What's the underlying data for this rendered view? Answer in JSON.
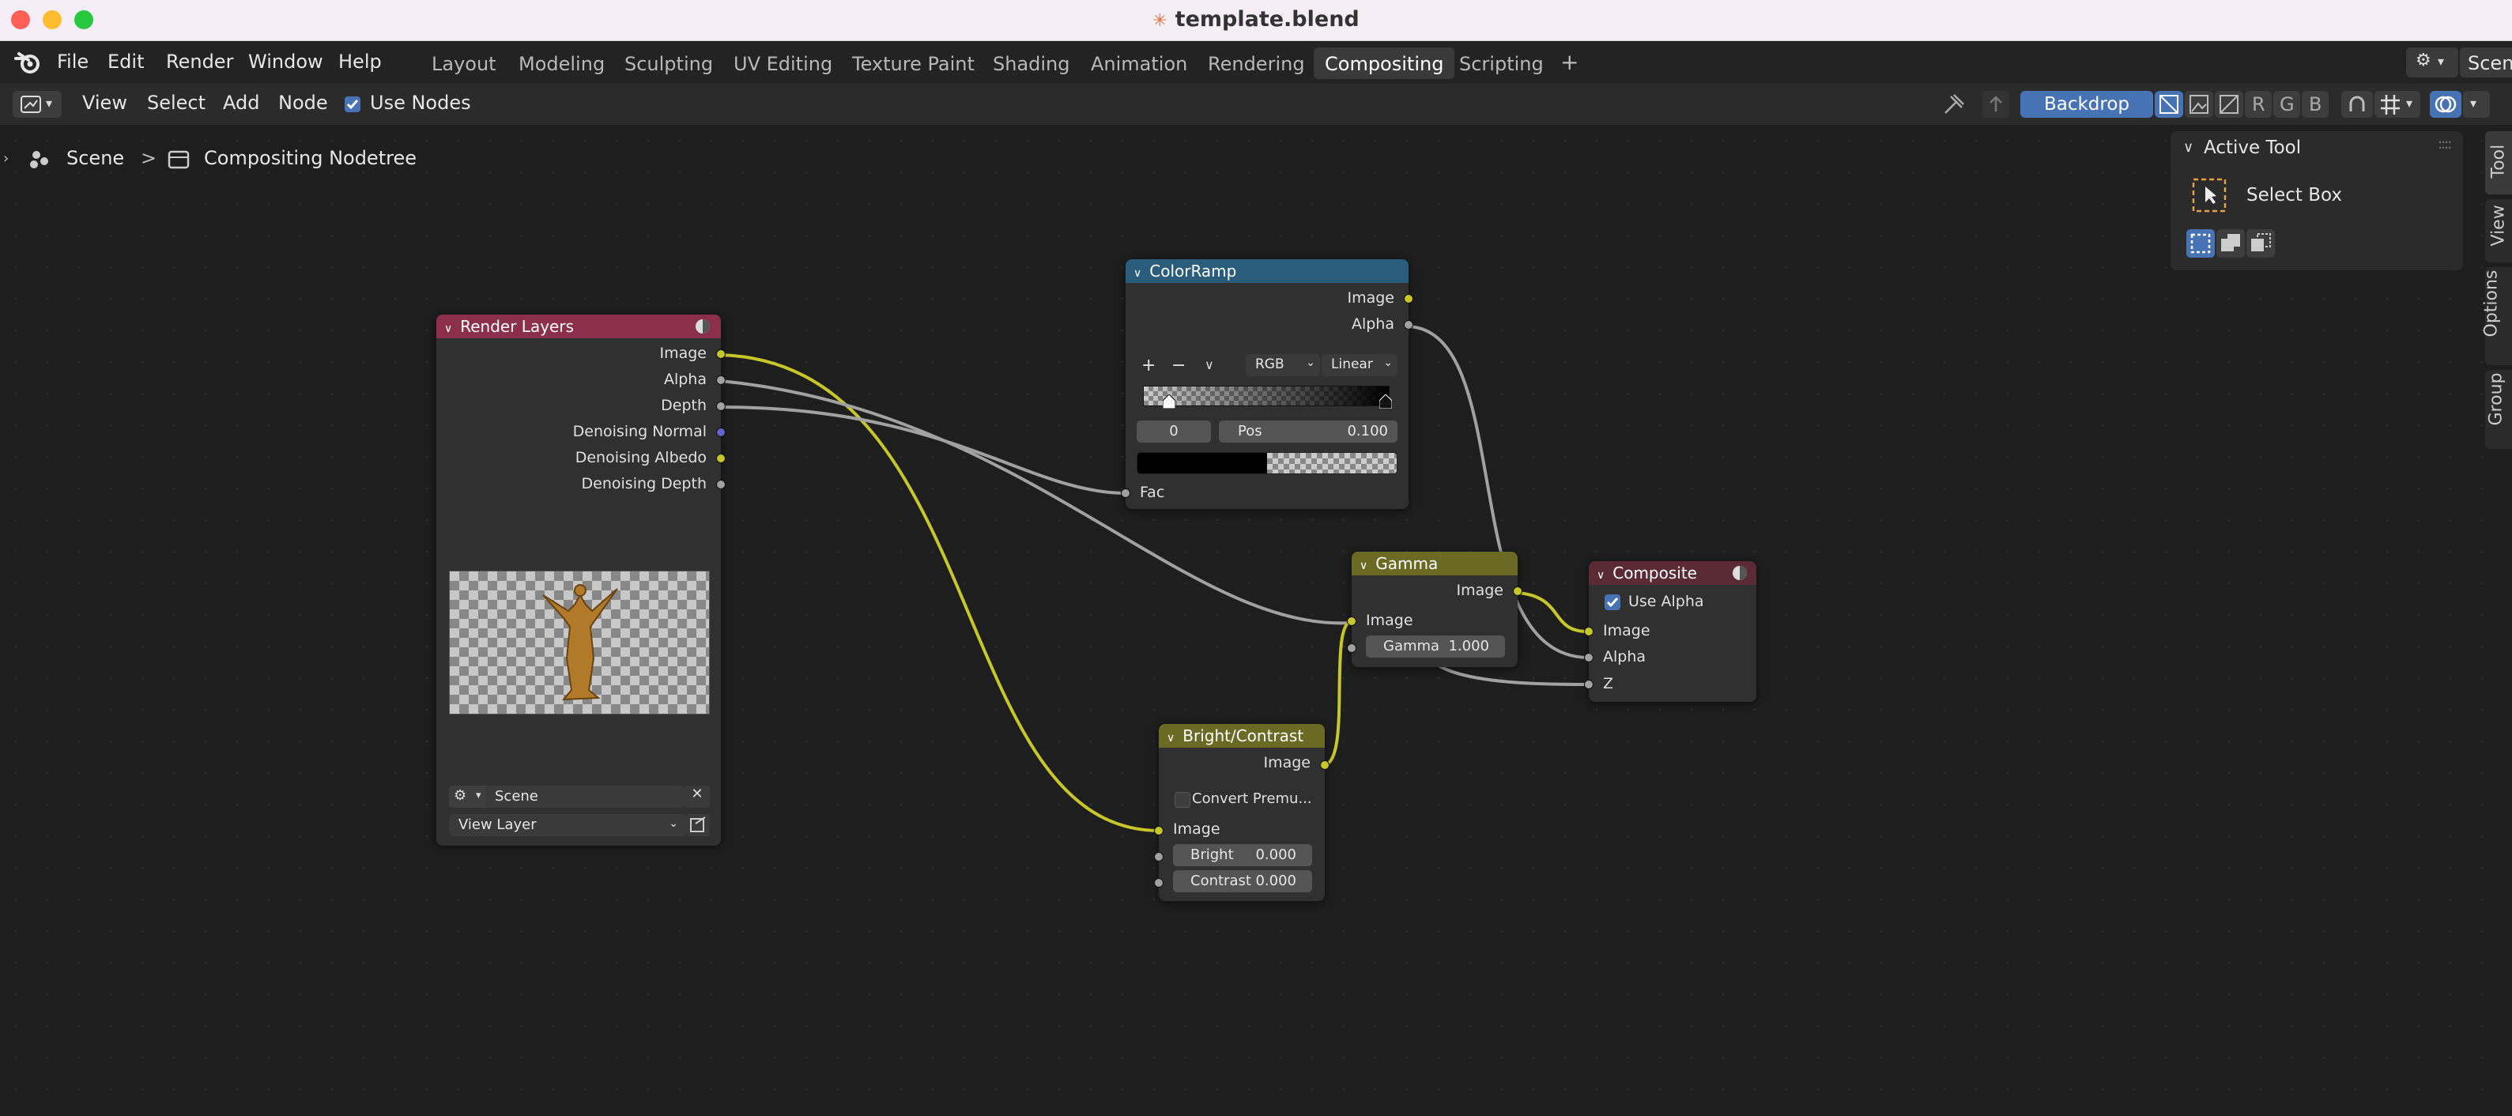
{
  "window": {
    "title": "template.blend"
  },
  "menubar": {
    "items": [
      "File",
      "Edit",
      "Render",
      "Window",
      "Help"
    ]
  },
  "workspaces": {
    "tabs": [
      "Layout",
      "Modeling",
      "Sculpting",
      "UV Editing",
      "Texture Paint",
      "Shading",
      "Animation",
      "Rendering",
      "Compositing",
      "Scripting"
    ],
    "active": "Compositing",
    "add_label": "+",
    "scene_label": "Scene"
  },
  "editor_header": {
    "view": "View",
    "select": "Select",
    "add": "Add",
    "node": "Node",
    "use_nodes_label": "Use Nodes",
    "use_nodes_checked": true,
    "backdrop_label": "Backdrop",
    "channel_r": "R",
    "channel_g": "G",
    "channel_b": "B"
  },
  "breadcrumb": {
    "scene": "Scene",
    "separator": ">",
    "nodetree": "Compositing Nodetree"
  },
  "sidebar": {
    "panel_title": "Active Tool",
    "tool_name": "Select Box",
    "tabs": [
      "Tool",
      "View",
      "Options",
      "Group"
    ]
  },
  "nodes": {
    "render_layers": {
      "title": "Render Layers",
      "header_color": "#8c2f4a",
      "outputs": [
        "Image",
        "Alpha",
        "Depth",
        "Denoising Normal",
        "Denoising Albedo",
        "Denoising Depth"
      ],
      "scene_field": "Scene",
      "view_layer_field": "View Layer"
    },
    "colorramp": {
      "title": "ColorRamp",
      "header_color": "#2a5c7c",
      "outputs": [
        "Image",
        "Alpha"
      ],
      "add_btn": "+",
      "remove_btn": "−",
      "color_mode": "RGB",
      "interpolation": "Linear",
      "stop_index": "0",
      "pos_label": "Pos",
      "pos_value": "0.100",
      "input": "Fac"
    },
    "gamma": {
      "title": "Gamma",
      "header_color": "#6a6a24",
      "output": "Image",
      "input": "Image",
      "gamma_label": "Gamma",
      "gamma_value": "1.000"
    },
    "composite": {
      "title": "Composite",
      "header_color": "#5a2a35",
      "use_alpha_label": "Use Alpha",
      "use_alpha_checked": true,
      "inputs": [
        "Image",
        "Alpha",
        "Z"
      ]
    },
    "bright_contrast": {
      "title": "Bright/Contrast",
      "header_color": "#6a6a24",
      "output": "Image",
      "convert_label": "Convert Premu...",
      "input": "Image",
      "bright_label": "Bright",
      "bright_value": "0.000",
      "contrast_label": "Contrast",
      "contrast_value": "0.000"
    }
  },
  "colors": {
    "accent_blue": "#4772b3",
    "link_yellow": "#c7c729",
    "link_gray": "#a1a1a1"
  }
}
